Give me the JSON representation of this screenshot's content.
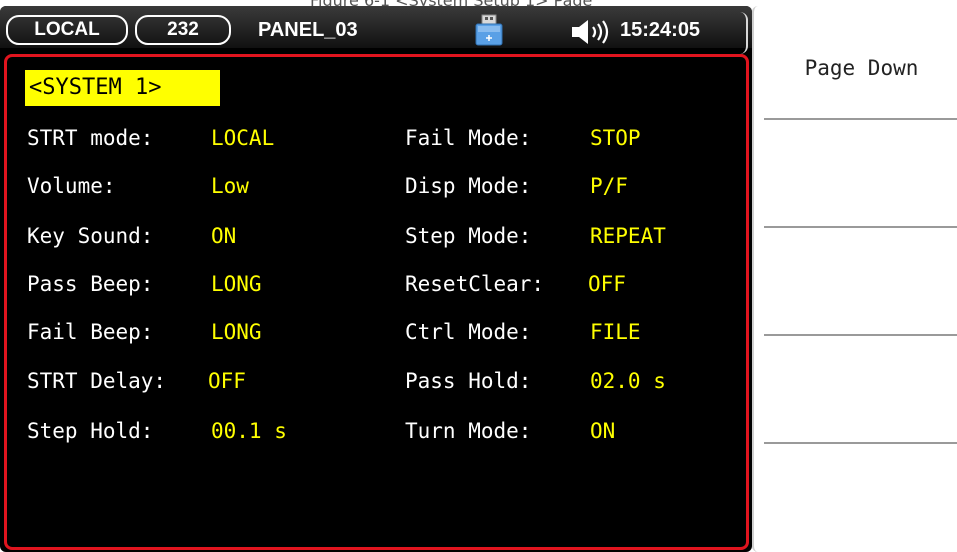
{
  "caption": "Figure 6-1 <System Setup 1> Page",
  "status_bar": {
    "mode": "LOCAL",
    "interface": "232",
    "panel": "PANEL_03",
    "usb_icon": "usb-drive-icon",
    "speaker_icon": "speaker-volume-icon",
    "time": "15:24:05"
  },
  "section_title": "<SYSTEM 1>",
  "params": {
    "left": [
      {
        "label": "STRT mode:",
        "value": "LOCAL"
      },
      {
        "label": "Volume:",
        "value": "Low"
      },
      {
        "label": "Key Sound:",
        "value": "ON"
      },
      {
        "label": "Pass Beep:",
        "value": "LONG"
      },
      {
        "label": "Fail Beep:",
        "value": "LONG"
      },
      {
        "label": "STRT Delay:",
        "value": "OFF"
      },
      {
        "label": "Step Hold:",
        "value": "00.1 s"
      }
    ],
    "right": [
      {
        "label": "Fail Mode:",
        "value": "STOP"
      },
      {
        "label": "Disp Mode:",
        "value": "P/F"
      },
      {
        "label": "Step Mode:",
        "value": "REPEAT"
      },
      {
        "label": "ResetClear:",
        "value": "OFF"
      },
      {
        "label": "Ctrl Mode:",
        "value": "FILE"
      },
      {
        "label": "Pass Hold:",
        "value": "02.0 s"
      },
      {
        "label": "Turn Mode:",
        "value": "ON"
      }
    ]
  },
  "softkeys": [
    "Page Down",
    "",
    "",
    "",
    ""
  ],
  "colors": {
    "value_text": "#ffff00",
    "label_text": "#ffffff",
    "panel_border": "#e0141e",
    "title_bg": "#ffff00"
  }
}
